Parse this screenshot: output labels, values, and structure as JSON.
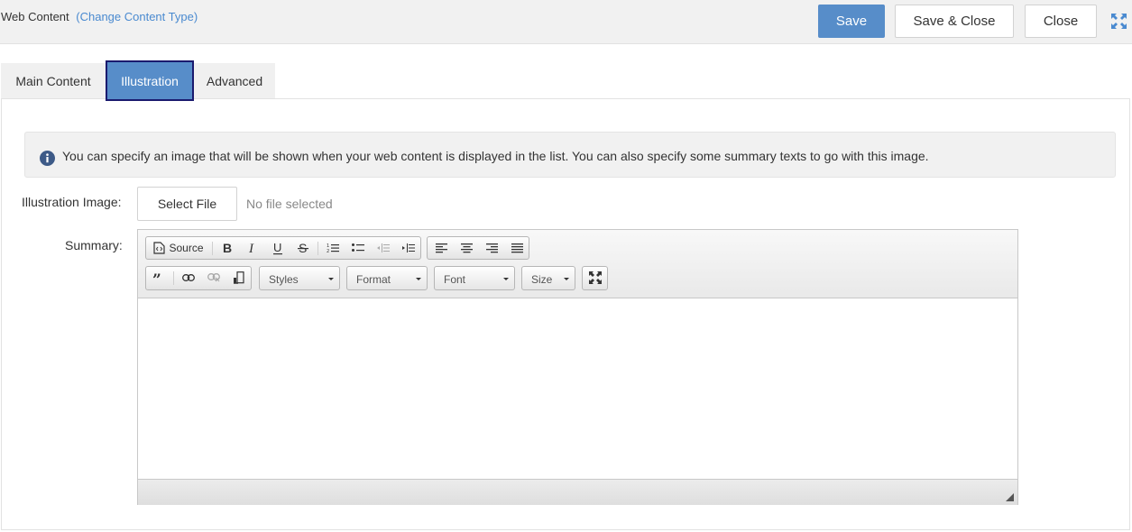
{
  "header": {
    "title": "Web Content",
    "change_link": "(Change Content Type)",
    "save_label": "Save",
    "save_close_label": "Save & Close",
    "close_label": "Close"
  },
  "tabs": [
    {
      "label": "Main Content",
      "active": false
    },
    {
      "label": "Illustration",
      "active": true
    },
    {
      "label": "Advanced",
      "active": false
    }
  ],
  "info": {
    "text": "You can specify an image that will be shown when your web content is displayed in the list. You can also specify some summary texts to go with this image."
  },
  "form": {
    "illustration_label": "Illustration Image:",
    "select_file_label": "Select File",
    "no_file_text": "No file selected",
    "summary_label": "Summary:"
  },
  "editor": {
    "source_label": "Source",
    "styles_value": "Styles",
    "format_value": "Format",
    "font_value": "Font",
    "size_value": "Size",
    "content": ""
  },
  "colors": {
    "primary": "#578dc9",
    "link": "#4a8ad0",
    "active_tab_border": "#1a1a6e"
  }
}
